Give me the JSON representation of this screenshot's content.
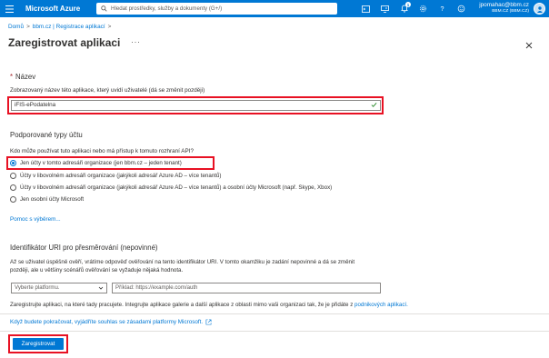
{
  "topbar": {
    "brand": "Microsoft Azure",
    "search_placeholder": "Hledat prostředky, služby a dokumenty (G+/)",
    "notification_count": "1",
    "account_email": "jpomahac@bbm.cz",
    "account_tenant": "BBM.CZ (BBM.CZ)"
  },
  "breadcrumb": [
    "Domů",
    "bbm.cz | Registrace aplikací"
  ],
  "page": {
    "title": "Zaregistrovat aplikaci",
    "more": "···"
  },
  "name_section": {
    "heading": "Název",
    "description": "Zobrazovaný název této aplikace, který uvidí uživatelé (dá se změnit později)",
    "value": "iFIS-ePodatelna"
  },
  "account_types": {
    "heading": "Podporované typy účtu",
    "question": "Kdo může používat tuto aplikaci nebo má přístup k tomuto rozhraní API?",
    "options": [
      "Jen účty v tomto adresáři organizace (jen bbm.cz – jeden tenant)",
      "Účty v libovolném adresáři organizace (jakýkoli adresář Azure AD – více tenantů)",
      "Účty v libovolném adresáři organizace (jakýkoli adresář Azure AD – více tenantů) a osobní účty Microsoft (např. Skype, Xbox)",
      "Jen osobní účty Microsoft"
    ],
    "selected_index": 0,
    "help_link": "Pomoc s výběrem..."
  },
  "redirect": {
    "heading": "Identifikátor URI pro přesměrování (nepovinné)",
    "description_line1": "Až se uživatel úspěšně ověří, vrátíme odpověď ověřování na tento identifikátor URI. V tomto okamžiku je zadání nepovinné a dá se změnit",
    "description_line2": "později, ale u většiny scénářů ověřování se vyžaduje nějaká hodnota.",
    "platform_placeholder": "Vyberte platformu.",
    "uri_placeholder": "Příklad: https://example.com/auth"
  },
  "notes": {
    "gallery_text": "Zaregistrujte aplikaci, na které tady pracujete. Integrujte aplikace galerie a další aplikace z oblasti mimo vaši organizaci tak, že je přidáte z",
    "gallery_link": "podnikových aplikací.",
    "policy_link": "Když budete pokračovat, vyjádříte souhlas se zásadami platformy Microsoft."
  },
  "footer": {
    "register_label": "Zaregistrovat"
  },
  "colors": {
    "accent": "#0078d4",
    "highlight": "#e81123"
  }
}
